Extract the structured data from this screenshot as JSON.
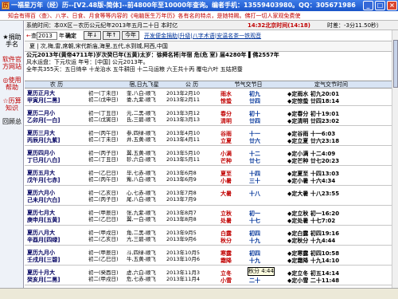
{
  "window": {
    "title": "一福星万年（经）历--[V2.48版-简体]--前4800年至10000年查询。编者手机：13559403980。QQ：305671986",
    "app_icon": "calendar-icon",
    "minimize_label": "_",
    "maximize_label": "□",
    "close_label": "×"
  },
  "banner": "知会有得百〈查〉、八字、日食、月食等等内容的《电脑医生万年历》各有名的特点，是她特赐。佛打一切人家观免费使",
  "sidebar": {
    "items": [
      {
        "label": "★捐助手名",
        "color": "#000000"
      },
      {
        "label": "软件官方网站",
        "color": "#c00000"
      },
      {
        "label": "◎使用帮助",
        "color": "#c00000"
      },
      {
        "label": "☆历算知识",
        "color": "#c00000"
      },
      {
        "label": "回顾总",
        "color": "#000000"
      }
    ]
  },
  "statusline": {
    "system_time": "系统时间：本0X区－农历公元纪年2013年五月二十日 本时亿",
    "beijing_time": "14:32北京时间(14:18)",
    "offset": "时差：-3分11.50秒）"
  },
  "toolbar": {
    "year_value": "2013",
    "year_suffix": "年",
    "confirm_label": "确定",
    "year_btn_label": "年↓",
    "month_btn_label": "年↑",
    "today_label": "今年",
    "links": "开发便金捐助|升级|八字术语|安温名茶一铁观音"
  },
  "city": "夏 | 次,梅,雷,席朝,宋代新庙,海里,五代,水到城,阿西,中国",
  "info": {
    "line1": "公元2013年(黄帝4711年)岁次癸巳年(五黄)太岁：徐舜名将|年宿 危(危 室) 届4280年 ▌佛2557年",
    "line2": "风水运盘：下元坎运 年号：[中国] 公元2013年。",
    "line3": "全年共355天：五日绮辛 十龙治水 五牛耕田 十二马运粮 六王共十丙 覆屯六叶 五姑把蚕"
  },
  "header": {
    "col1": "农 历",
    "col2": "宿,日九飞星",
    "col3": "公 历",
    "col4": "节气交节日",
    "col5": "定气交节时间"
  },
  "rows": [
    {
      "month": [
        "夏历正月大",
        "甲寅月[二黑]"
      ],
      "days": [
        "初一(丁未日)",
        "初二(戊申日)"
      ],
      "stars": [
        "奎,八白-顺飞",
        "娄,九紫-顺飞"
      ],
      "dates": [
        "2013年2月10",
        "2013年2月11"
      ],
      "jq": [
        "雨水",
        "惊蛰"
      ],
      "jt": [
        "初九",
        "廿四"
      ],
      "dq": [
        "◆定雨水 初九20:01",
        "◆定惊蛰 廿四18:14"
      ]
    },
    {
      "month": [
        "夏历二月小",
        "乙卯月[一白]"
      ],
      "days": [
        "初一(丁丑日)",
        "初二(戊寅日)"
      ],
      "stars": [
        "元,二黑-顺飞",
        "氐,三碧-顺飞"
      ],
      "dates": [
        "2013年3月12",
        "2013年3月13"
      ],
      "jq": [
        "春分",
        "清明"
      ],
      "jt": [
        "初十",
        "廿四"
      ],
      "dq": [
        "◆定春分 初十19:01",
        "◆定清明 廿四23:02"
      ]
    },
    {
      "month": [
        "夏历三月大",
        "丙辰月[九紫]"
      ],
      "days": [
        "初一(丙午日)",
        "初二(丁未日)"
      ],
      "stars": [
        "参,四绿-顺飞",
        "井,五黄-顺飞"
      ],
      "dates": [
        "2013年4月10",
        "2013年4月11"
      ],
      "jq": [
        "谷雨",
        "立夏"
      ],
      "jt": [
        "十一",
        "廿六"
      ],
      "dq": [
        "◆定谷雨 十一6:03",
        "◆定立夏 廿六23:18"
      ]
    },
    {
      "month": [
        "夏历四月小",
        "丁巳月[八白]"
      ],
      "days": [
        "初一(丙子日)",
        "初二(丁丑日)"
      ],
      "stars": [
        "翼,五黄-顺飞",
        "轸,六白-顺飞"
      ],
      "dates": [
        "2013年5月10",
        "2013年5月11"
      ],
      "jq": [
        "小满",
        "芒种"
      ],
      "jt": [
        "十二",
        "廿七"
      ],
      "dq": [
        "◆定小满 十二4:09",
        "◆定芒种 廿七20:23"
      ]
    },
    {
      "month": [
        "夏历五月大",
        "戊午月[七赤]"
      ],
      "days": [
        "初一(乙巳日)",
        "初二(丙午日)"
      ],
      "stars": [
        "毕,七赤-顺飞",
        "觜,八白-顺飞"
      ],
      "dates": [
        "2013年6月8",
        "2013年6月9"
      ],
      "jq": [
        "夏至",
        "小暑"
      ],
      "jt": [
        "十四",
        "三十"
      ],
      "dq": [
        "◆定夏至 十四13:03",
        "◆定小暑 十六4:34"
      ]
    },
    {
      "month": [
        "夏历六月小",
        "己未月[六白]"
      ],
      "days": [
        "初一(乙亥日)",
        "初二(丙子日)"
      ],
      "stars": [
        "心,七赤-顺飞",
        "尾,八白-顺飞"
      ],
      "dates": [
        "2013年7月8",
        "2013年7月9"
      ],
      "jq": [
        "大暑",
        ""
      ],
      "jt": [
        "十八",
        ""
      ],
      "dq": [
        "◆定大暑 十八23:55",
        ""
      ]
    },
    {
      "month": [
        "夏历七月大",
        "庚申月[五黄]"
      ],
      "days": [
        "初一(甲辰日)",
        "初二(乙巳日)"
      ],
      "stars": [
        "张,九紫-顺飞",
        "翼,一白-顺飞"
      ],
      "dates": [
        "2013年8月7",
        "2013年8月8"
      ],
      "jq": [
        "立秋",
        "处暑"
      ],
      "jt": [
        "初一",
        "十七"
      ],
      "dq": [
        "◆定立秋 初一16:20",
        "◆定处暑 十七7:02"
      ]
    },
    {
      "month": [
        "夏历八月大",
        "辛酉月[四绿]"
      ],
      "days": [
        "初一(甲戌日)",
        "初二(乙亥日)"
      ],
      "stars": [
        "角,二黑-顺飞",
        "亢,三碧-顺飞"
      ],
      "dates": [
        "2013年9月5",
        "2013年9月6"
      ],
      "jq": [
        "白露",
        "秋分"
      ],
      "jt": [
        "初四",
        "十九"
      ],
      "dq": [
        "◆定白露 初四19:16",
        "◆定秋分 十九4:44"
      ]
    },
    {
      "month": [
        "夏历九月小",
        "壬戌月[三碧]"
      ],
      "days": [
        "初一(甲辰日)",
        "初二(乙巳日)"
      ],
      "stars": [
        "斗,四绿-顺飞",
        "牛,五黄-顺飞"
      ],
      "dates": [
        "2013年10月5",
        "2013年10月6"
      ],
      "jq": [
        "寒露",
        "霜降"
      ],
      "jt": [
        "初四",
        "十九"
      ],
      "dq": [
        "◆定寒露 初四10:58",
        "◆定霜降 十九14:10"
      ]
    },
    {
      "month": [
        "夏历十月大",
        "癸亥月[二黑]"
      ],
      "days": [
        "初一(癸酉日)",
        "初二(甲戌日)"
      ],
      "stars": [
        "虚,六白-顺飞",
        "危,七赤-顺飞"
      ],
      "dates": [
        "2013年11月3",
        "2013年11月4"
      ],
      "jq": [
        "立冬",
        "小雪"
      ],
      "jt": [
        "初五",
        "二十"
      ],
      "dq": [
        "◆定立冬 初五14:14",
        "◆定小雪 二十11:48"
      ]
    }
  ],
  "tooltip": "秋分 4:44"
}
